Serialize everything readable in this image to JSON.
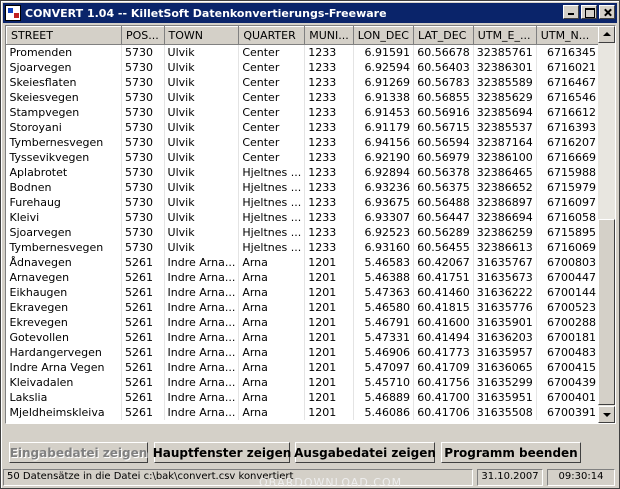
{
  "window": {
    "title": "CONVERT 1.04 -- KilletSoft Datenkonvertierungs-Freeware"
  },
  "table": {
    "columns": [
      "STREET",
      "POS...",
      "TOWN",
      "QUARTER",
      "MUNI...",
      "LON_DEC",
      "LAT_DEC",
      "UTM_E_...",
      "UTM_N..."
    ],
    "rows": [
      [
        "Promenden",
        "5730",
        "Ulvik",
        "Center",
        "1233",
        "6.91591",
        "60.56678",
        "32385761",
        "6716345"
      ],
      [
        "Sjoarvegen",
        "5730",
        "Ulvik",
        "Center",
        "1233",
        "6.92594",
        "60.56403",
        "32386301",
        "6716021"
      ],
      [
        "Skeiesflaten",
        "5730",
        "Ulvik",
        "Center",
        "1233",
        "6.91269",
        "60.56783",
        "32385589",
        "6716467"
      ],
      [
        "Skeiesvegen",
        "5730",
        "Ulvik",
        "Center",
        "1233",
        "6.91338",
        "60.56855",
        "32385629",
        "6716546"
      ],
      [
        "Stampvegen",
        "5730",
        "Ulvik",
        "Center",
        "1233",
        "6.91453",
        "60.56916",
        "32385694",
        "6716612"
      ],
      [
        "Storoyani",
        "5730",
        "Ulvik",
        "Center",
        "1233",
        "6.91179",
        "60.56715",
        "32385537",
        "6716393"
      ],
      [
        "Tymbernesvegen",
        "5730",
        "Ulvik",
        "Center",
        "1233",
        "6.94156",
        "60.56594",
        "32387164",
        "6716207"
      ],
      [
        "Tyssevikvegen",
        "5730",
        "Ulvik",
        "Center",
        "1233",
        "6.92190",
        "60.56979",
        "32386100",
        "6716669"
      ],
      [
        "Aplabrotet",
        "5730",
        "Ulvik",
        "Hjeltnes ...",
        "1233",
        "6.92894",
        "60.56378",
        "32386465",
        "6715988"
      ],
      [
        "Bodnen",
        "5730",
        "Ulvik",
        "Hjeltnes ...",
        "1233",
        "6.93236",
        "60.56375",
        "32386652",
        "6715979"
      ],
      [
        "Furehaug",
        "5730",
        "Ulvik",
        "Hjeltnes ...",
        "1233",
        "6.93675",
        "60.56488",
        "32386897",
        "6716097"
      ],
      [
        "Kleivi",
        "5730",
        "Ulvik",
        "Hjeltnes ...",
        "1233",
        "6.93307",
        "60.56447",
        "32386694",
        "6716058"
      ],
      [
        "Sjoarvegen",
        "5730",
        "Ulvik",
        "Hjeltnes ...",
        "1233",
        "6.92523",
        "60.56289",
        "32386259",
        "6715895"
      ],
      [
        "Tymbernesvegen",
        "5730",
        "Ulvik",
        "Hjeltnes ...",
        "1233",
        "6.93160",
        "60.56455",
        "32386613",
        "6716069"
      ],
      [
        "Ådnavegen",
        "5261",
        "Indre Arna...",
        "Arna",
        "1201",
        "5.46583",
        "60.42067",
        "31635767",
        "6700803"
      ],
      [
        "Arnavegen",
        "5261",
        "Indre Arna...",
        "Arna",
        "1201",
        "5.46388",
        "60.41751",
        "31635673",
        "6700447"
      ],
      [
        "Eikhaugen",
        "5261",
        "Indre Arna...",
        "Arna",
        "1201",
        "5.47363",
        "60.41460",
        "31636222",
        "6700144"
      ],
      [
        "Ekravegen",
        "5261",
        "Indre Arna...",
        "Arna",
        "1201",
        "5.46580",
        "60.41815",
        "31635776",
        "6700523"
      ],
      [
        "Ekrevegen",
        "5261",
        "Indre Arna...",
        "Arna",
        "1201",
        "5.46791",
        "60.41600",
        "31635901",
        "6700288"
      ],
      [
        "Gotevollen",
        "5261",
        "Indre Arna...",
        "Arna",
        "1201",
        "5.47331",
        "60.41494",
        "31636203",
        "6700181"
      ],
      [
        "Hardangervegen",
        "5261",
        "Indre Arna...",
        "Arna",
        "1201",
        "5.46906",
        "60.41773",
        "31635957",
        "6700483"
      ],
      [
        "Indre Arna Vegen",
        "5261",
        "Indre Arna...",
        "Arna",
        "1201",
        "5.47097",
        "60.41709",
        "31636065",
        "6700415"
      ],
      [
        "Kleivadalen",
        "5261",
        "Indre Arna...",
        "Arna",
        "1201",
        "5.45710",
        "60.41756",
        "31635299",
        "6700439"
      ],
      [
        "Lakslia",
        "5261",
        "Indre Arna...",
        "Arna",
        "1201",
        "5.46889",
        "60.41700",
        "31635951",
        "6700401"
      ],
      [
        "Mjeldheimskleiva",
        "5261",
        "Indre Arna...",
        "Arna",
        "1201",
        "5.46086",
        "60.41706",
        "31635508",
        "6700391"
      ]
    ]
  },
  "buttons": {
    "input_file": "Eingabedatei zeigen",
    "main_window": "Hauptfenster zeigen",
    "output_file": "Ausgabedatei zeigen",
    "quit": "Programm beenden"
  },
  "status": {
    "message": "50 Datensätze in die Datei c:\\bak\\convert.csv konvertiert",
    "date": "31.10.2007",
    "time": "09:30:14"
  },
  "watermark": "OBARDOWNLOAD.COM"
}
